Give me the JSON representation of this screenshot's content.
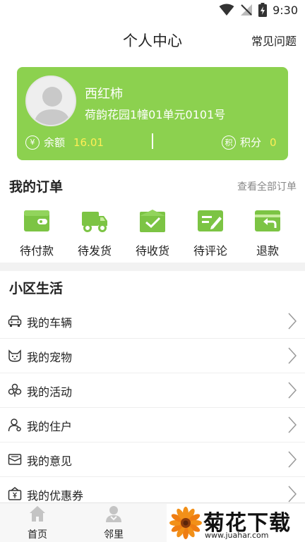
{
  "status_bar": {
    "time": "9:30"
  },
  "header": {
    "title": "个人中心",
    "faq": "常见问题"
  },
  "profile": {
    "name": "西红柿",
    "address": "荷韵花园1幢01单元0101号",
    "balance_icon": "¥",
    "balance_label": "余额",
    "balance_value": "16.01",
    "points_icon": "积",
    "points_label": "积分",
    "points_value": "0"
  },
  "orders": {
    "title": "我的订单",
    "view_all": "查看全部订单",
    "items": [
      {
        "label": "待付款",
        "icon": "wallet-icon"
      },
      {
        "label": "待发货",
        "icon": "truck-icon"
      },
      {
        "label": "待收货",
        "icon": "box-check-icon"
      },
      {
        "label": "待评论",
        "icon": "review-icon"
      },
      {
        "label": "退款",
        "icon": "refund-icon"
      }
    ]
  },
  "community": {
    "title": "小区生活",
    "items": [
      {
        "label": "我的车辆",
        "icon": "car-icon"
      },
      {
        "label": "我的宠物",
        "icon": "cat-icon"
      },
      {
        "label": "我的活动",
        "icon": "activity-icon"
      },
      {
        "label": "我的住户",
        "icon": "resident-icon"
      },
      {
        "label": "我的意见",
        "icon": "feedback-icon"
      },
      {
        "label": "我的优惠券",
        "icon": "coupon-icon"
      }
    ]
  },
  "tabbar": {
    "items": [
      {
        "label": "首页",
        "icon": "home-icon"
      },
      {
        "label": "邻里",
        "icon": "neighbor-icon"
      }
    ]
  },
  "watermark": {
    "title": "菊花下载网",
    "url": "www.juahar.com"
  },
  "colors": {
    "accent": "#8cd14f",
    "value_yellow": "#ffee55",
    "icon_green": "#7cc444"
  }
}
